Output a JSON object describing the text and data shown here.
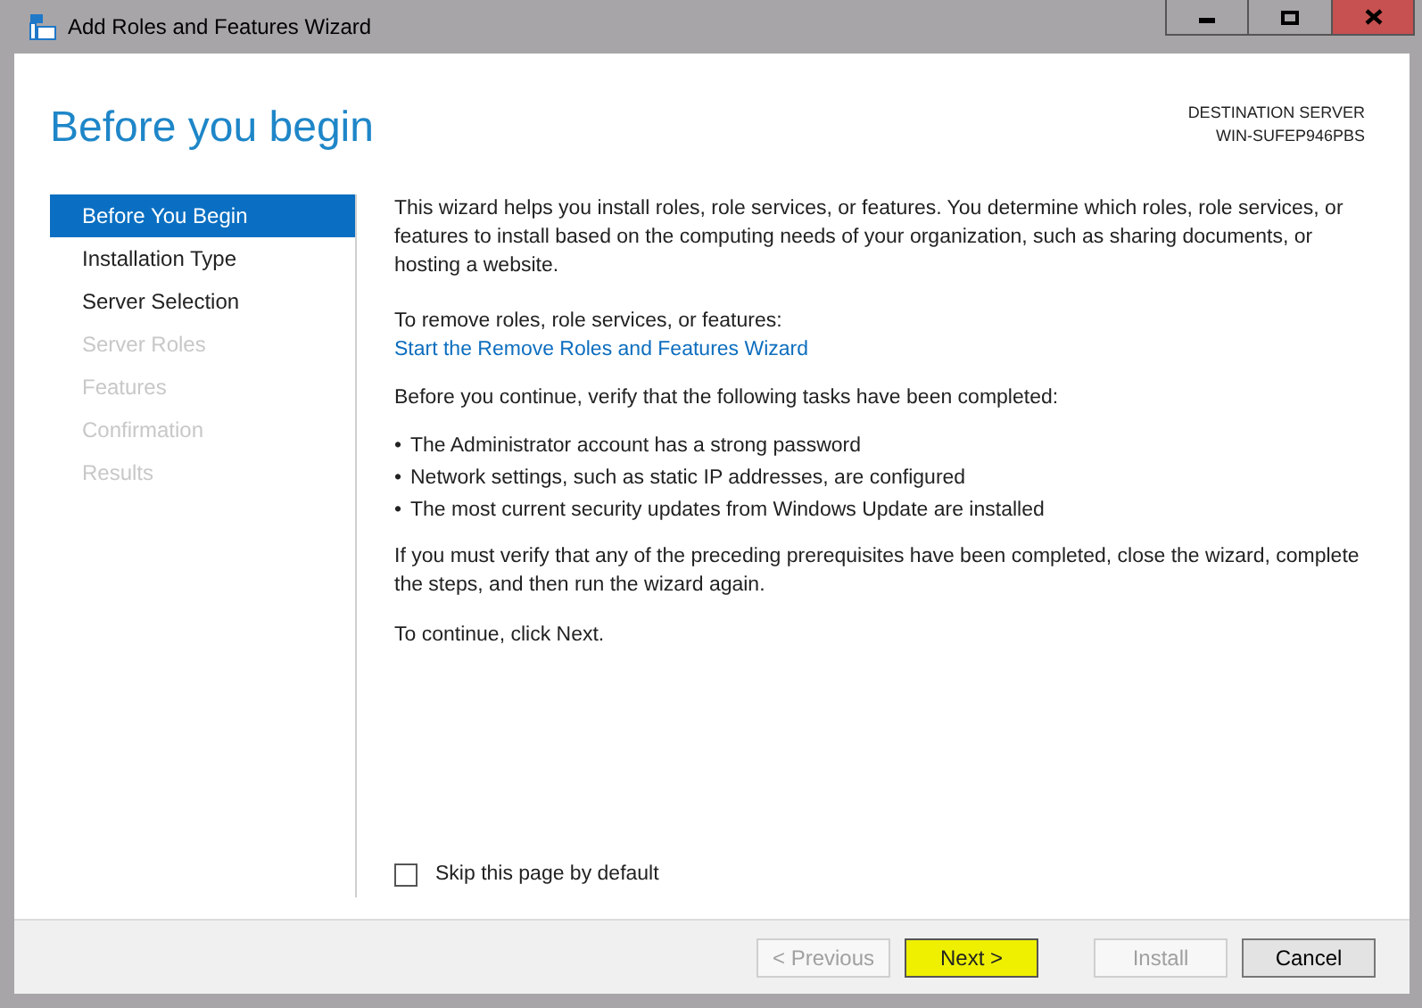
{
  "window": {
    "title": "Add Roles and Features Wizard"
  },
  "page_title": "Before you begin",
  "destination": {
    "label": "DESTINATION SERVER",
    "server": "WIN-SUFEP946PBS"
  },
  "sidebar": {
    "items": [
      {
        "label": "Before You Begin",
        "selected": true,
        "disabled": false
      },
      {
        "label": "Installation Type",
        "selected": false,
        "disabled": false
      },
      {
        "label": "Server Selection",
        "selected": false,
        "disabled": false
      },
      {
        "label": "Server Roles",
        "selected": false,
        "disabled": true
      },
      {
        "label": "Features",
        "selected": false,
        "disabled": true
      },
      {
        "label": "Confirmation",
        "selected": false,
        "disabled": true
      },
      {
        "label": "Results",
        "selected": false,
        "disabled": true
      }
    ]
  },
  "content": {
    "intro": "This wizard helps you install roles, role services, or features. You determine which roles, role services, or features to install based on the computing needs of your organization, such as sharing documents, or hosting a website.",
    "remove_text": "To remove roles, role services, or features:",
    "remove_link": "Start the Remove Roles and Features Wizard",
    "verify_text": "Before you continue, verify that the following tasks have been completed:",
    "bullets": [
      {
        "mark": "•",
        "text": "The Administrator account has a strong password"
      },
      {
        "mark": "•",
        "text": "Network settings, such as static IP addresses, are configured"
      },
      {
        "mark": "•",
        "text": "The most current security updates from Windows Update are installed"
      }
    ],
    "prereq_text": "If you must verify that any of the preceding prerequisites have been completed, close the wizard, complete the steps, and then run the wizard again.",
    "continue_text": "To continue, click Next."
  },
  "skip_checkbox": {
    "label": "Skip this page by default",
    "checked": false
  },
  "buttons": [
    {
      "label": "< Previous",
      "disabled": true,
      "highlighted": false
    },
    {
      "label": "Next >",
      "disabled": false,
      "highlighted": true
    },
    {
      "label": "Install",
      "disabled": true,
      "highlighted": false
    },
    {
      "label": "Cancel",
      "disabled": false,
      "highlighted": false
    }
  ]
}
